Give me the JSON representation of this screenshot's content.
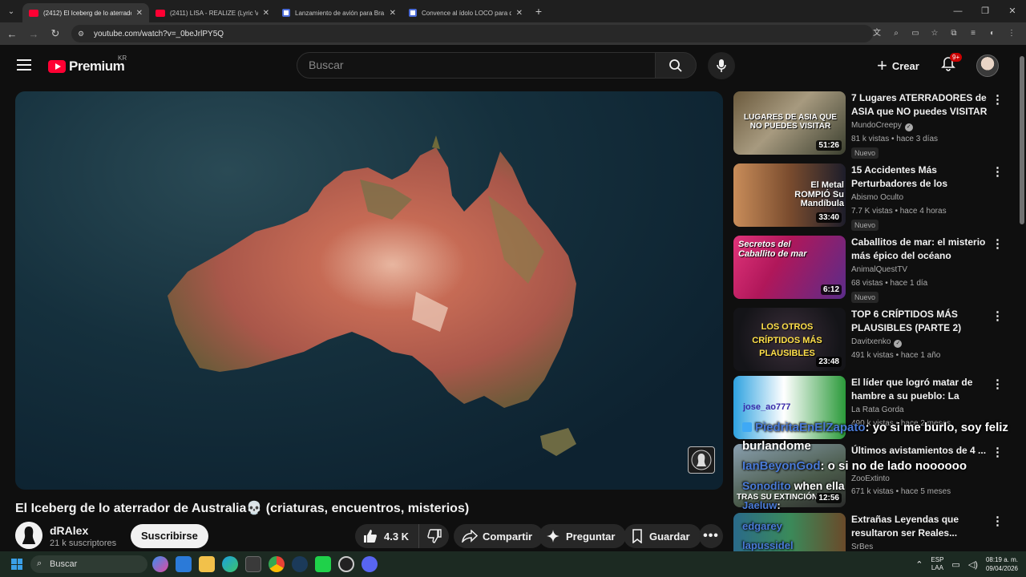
{
  "browser": {
    "tabs": [
      {
        "title": "(2412) El Iceberg de lo aterrador",
        "favicon": "youtube-icon",
        "active": true
      },
      {
        "title": "(2411) LISA - REALIZE (Lyric Video",
        "favicon": "youtube-icon",
        "active": false
      },
      {
        "title": "Lanzamiento de avión para Bra",
        "favicon": "chat-icon",
        "active": false
      },
      {
        "title": "Convence al ídolo LOCO para q",
        "favicon": "chat-icon",
        "active": false
      }
    ],
    "url": "youtube.com/watch?v=_0beJrlPY5Q"
  },
  "header": {
    "logo_text": "Premium",
    "country_code": "KR",
    "search_placeholder": "Buscar",
    "create_label": "Crear",
    "notifications_badge": "9+"
  },
  "video": {
    "title": "El Iceberg de lo aterrador de Australia💀 (criaturas, encuentros, misterios)",
    "channel": "dRAlex",
    "subscribers": "21 k suscriptores",
    "subscribe_label": "Suscribirse",
    "likes": "4.3 K",
    "share_label": "Compartir",
    "ask_label": "Preguntar",
    "save_label": "Guardar"
  },
  "recommendations": [
    {
      "title": "7 Lugares ATERRADORES de ASIA que NO puedes VISITAR ...",
      "channel": "MundoCreepy",
      "verified": true,
      "meta": "81 k vistas • hace 3 días",
      "badge": "Nuevo",
      "duration": "51:26",
      "thumb_text": "LUGARES DE ASIA QUE NO PUEDES VISITAR"
    },
    {
      "title": "15 Accidentes Más Perturbadores de los Récords ...",
      "channel": "Abismo Oculto",
      "verified": false,
      "meta": "7.7 K vistas • hace 4 horas",
      "badge": "Nuevo",
      "duration": "33:40",
      "thumb_text": "El Metal ROMPIÓ Su Mandíbula"
    },
    {
      "title": "Caballitos de mar: el misterio más épico del océano",
      "channel": "AnimalQuestTV",
      "verified": false,
      "meta": "68 vistas • hace 1 día",
      "badge": "Nuevo",
      "duration": "6:12",
      "thumb_text": "Secretos del Caballito de mar"
    },
    {
      "title": "TOP 6 CRÍPTIDOS MÁS PLAUSIBLES (PARTE 2)",
      "channel": "Davitxenko",
      "verified": true,
      "meta": "491 k vistas • hace 1 año",
      "badge": "",
      "duration": "23:48",
      "thumb_text": "LOS OTROS CRÍPTIDOS MÁS PLAUSIBLES"
    },
    {
      "title": "El líder que logró matar de hambre a su pueblo: La Corea ...",
      "channel": "La Rata Gorda",
      "verified": false,
      "meta": "490 k vistas • hace 2 meses",
      "badge": "",
      "duration": "",
      "thumb_text": "jose_ao777"
    },
    {
      "title": "Últimos avistamientos de 4 ...",
      "channel": "ZooExtinto",
      "verified": false,
      "meta": "671 k vistas • hace 5 meses",
      "badge": "",
      "duration": "12:56",
      "thumb_text": "TRAS SU EXTINCIÓN"
    },
    {
      "title": "Extrañas Leyendas que resultaron ser Reales...",
      "channel": "SrBes",
      "verified": false,
      "meta": "",
      "badge": "",
      "duration": "",
      "thumb_text": ""
    }
  ],
  "chat_overlay": [
    {
      "user": "PiedritaEnElZapato",
      "message": ": yo si me burlo, soy feliz"
    },
    {
      "user": "",
      "message": "burlandome"
    },
    {
      "user": "IanBeyonGod",
      "message": ": o si no de lado noooooo"
    },
    {
      "user": "Sonodito",
      "message": " when ella"
    },
    {
      "user": "Jaeluw",
      "message": ":"
    },
    {
      "user": "edgarey",
      "message": ""
    },
    {
      "user": "lapussidel",
      "message": ""
    }
  ],
  "taskbar": {
    "search_label": "Buscar",
    "lang_line1": "ESP",
    "lang_line2": "LAA",
    "time": "08:19 a. m.",
    "date": "09/04/2026"
  },
  "colors": {
    "youtube_red": "#ff0033",
    "background": "#0f0f0f",
    "chat_username": "#4a7bd8"
  }
}
